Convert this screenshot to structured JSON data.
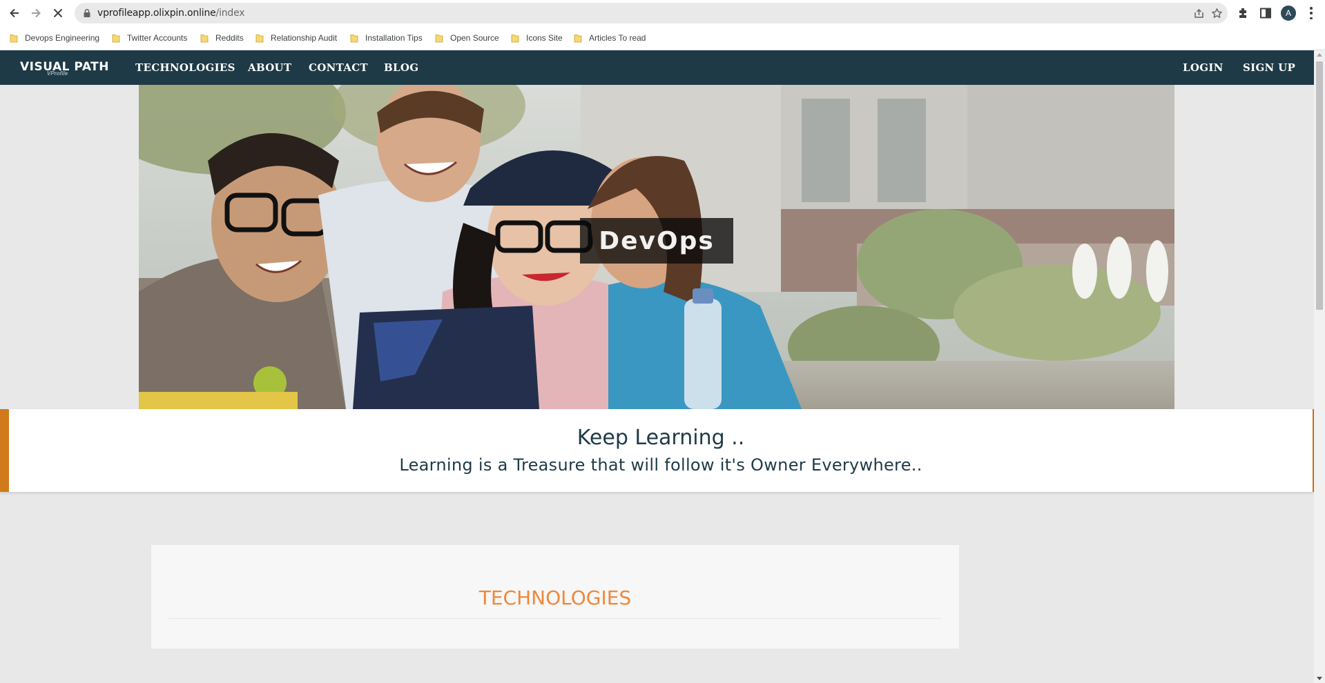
{
  "browser": {
    "url_host": "vprofileapp.olixpin.online",
    "url_path": "/index",
    "avatar_letter": "A",
    "bookmarks": [
      {
        "label": "Devops Engineering"
      },
      {
        "label": "Twitter Accounts"
      },
      {
        "label": "Reddits"
      },
      {
        "label": "Relationship Audit"
      },
      {
        "label": "Installation Tips"
      },
      {
        "label": "Open Source"
      },
      {
        "label": "Icons Site"
      },
      {
        "label": "Articles To read"
      }
    ]
  },
  "navbar": {
    "brand": "VISUAL PATH",
    "brand_sub": "VProfile",
    "links": [
      "TECHNOLOGIES",
      "ABOUT",
      "CONTACT",
      "BLOG"
    ],
    "login": "LOGIN",
    "signup": "SIGN UP"
  },
  "hero": {
    "caption": "DevOps"
  },
  "quote": {
    "title": "Keep Learning ..",
    "text": "Learning is a Treasure that will follow it's Owner Everywhere.."
  },
  "section": {
    "title": "TECHNOLOGIES"
  },
  "colors": {
    "navbar": "#1e3a47",
    "accent_orange": "#d07a1b",
    "section_title": "#f0873a"
  }
}
